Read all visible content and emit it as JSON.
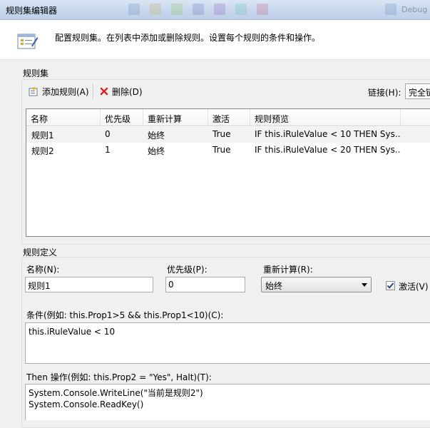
{
  "window": {
    "title": "规则集编辑器",
    "bg_ghost_text": "Debug"
  },
  "header": {
    "description": "配置规则集。在列表中添加或删除规则。设置每个规则的条件和操作。"
  },
  "ruleset": {
    "group_label": "规则集",
    "add_button": "添加规则(A)",
    "delete_button": "删除(D)",
    "chaining_label": "链接(H):",
    "chaining_value": "完全链",
    "columns": [
      "名称",
      "优先级",
      "重新计算",
      "激活",
      "规则预览"
    ],
    "rows": [
      {
        "name": "规则1",
        "priority": "0",
        "reevaluation": "始终",
        "active": "True",
        "preview": "IF this.iRuleValue < 10 THEN Sys..."
      },
      {
        "name": "规则2",
        "priority": "1",
        "reevaluation": "始终",
        "active": "True",
        "preview": "IF this.iRuleValue < 20 THEN Sys..."
      }
    ]
  },
  "definition": {
    "group_label": "规则定义",
    "name_label": "名称(N):",
    "name_value": "规则1",
    "priority_label": "优先级(P):",
    "priority_value": "0",
    "reeval_label": "重新计算(R):",
    "reeval_value": "始终",
    "active_label": "激活(V)",
    "active_checked": true,
    "condition_label": "条件(例如: this.Prop1>5 && this.Prop1<10)(C):",
    "condition_value": "this.iRuleValue < 10",
    "then_label": "Then 操作(例如: this.Prop2 = \"Yes\", Halt)(T):",
    "then_value": "System.Console.WriteLine(\"当前是规则2\")\nSystem.Console.ReadKey()"
  },
  "colors": {
    "delete_icon": "#d9261c",
    "titlebar_top": "#dbe6f4",
    "group_border": "#d5dfe5"
  }
}
